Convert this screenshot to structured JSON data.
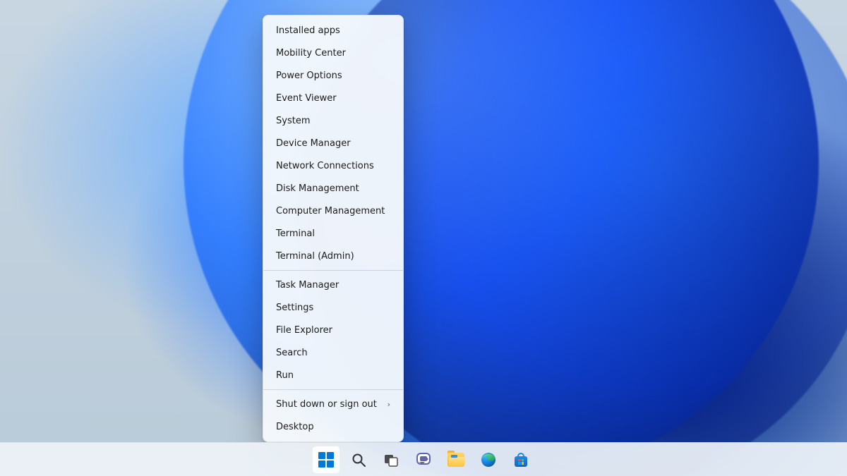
{
  "context_menu": {
    "group1": [
      "Installed apps",
      "Mobility Center",
      "Power Options",
      "Event Viewer",
      "System",
      "Device Manager",
      "Network Connections",
      "Disk Management",
      "Computer Management",
      "Terminal",
      "Terminal (Admin)"
    ],
    "group2": [
      "Task Manager",
      "Settings",
      "File Explorer",
      "Search",
      "Run"
    ],
    "group3_submenu_label": "Shut down or sign out",
    "group3_last": "Desktop"
  },
  "taskbar": {
    "items": [
      {
        "id": "start",
        "name": "start-button",
        "active": true
      },
      {
        "id": "search",
        "name": "search-button",
        "active": false
      },
      {
        "id": "task-view",
        "name": "task-view-button",
        "active": false
      },
      {
        "id": "chat",
        "name": "chat-button",
        "active": false
      },
      {
        "id": "file-explorer",
        "name": "file-explorer-button",
        "active": false
      },
      {
        "id": "edge",
        "name": "edge-button",
        "active": false
      },
      {
        "id": "store",
        "name": "store-button",
        "active": false
      }
    ]
  },
  "colors": {
    "accent": "#0078d4",
    "menu_bg": "#f4f8fc",
    "taskbar_bg": "#eef3f8"
  }
}
